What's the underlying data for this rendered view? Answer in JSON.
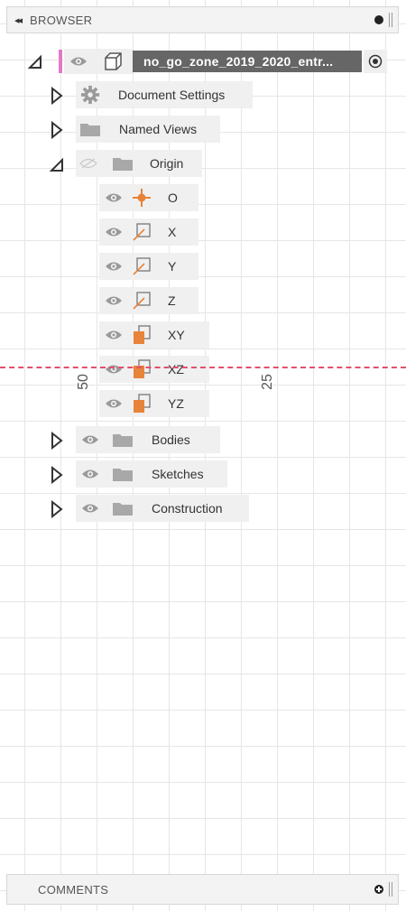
{
  "browser": {
    "title": "BROWSER",
    "collapse_glyph": "◂◂",
    "root": {
      "name": "no_go_zone_2019_2020_entr..."
    },
    "items": {
      "document_settings": "Document Settings",
      "named_views": "Named Views",
      "origin": "Origin",
      "origin_children": [
        "O",
        "X",
        "Y",
        "Z",
        "XY",
        "XZ",
        "YZ"
      ],
      "bodies": "Bodies",
      "sketches": "Sketches",
      "construction": "Construction"
    }
  },
  "canvas": {
    "ruler_labels": [
      "50",
      "25"
    ]
  },
  "comments": {
    "title": "COMMENTS"
  },
  "colors": {
    "origin_orange": "#e8833a",
    "plane_orange": "#e8833a",
    "active_accent": "#e37ac4",
    "construction_line": "#e2506a"
  },
  "icons": {
    "collapse": "double-left-arrow-icon",
    "expand": "triangle-right-outline-icon",
    "expanded": "triangle-down-filled-icon",
    "eye": "eye-icon",
    "eye_hidden": "eye-hidden-icon",
    "folder": "folder-icon",
    "gear": "gear-icon",
    "component": "component-box-icon",
    "radio": "activate-radio-icon",
    "origin_point": "origin-point-icon",
    "axis": "axis-icon",
    "plane": "plane-icon"
  }
}
